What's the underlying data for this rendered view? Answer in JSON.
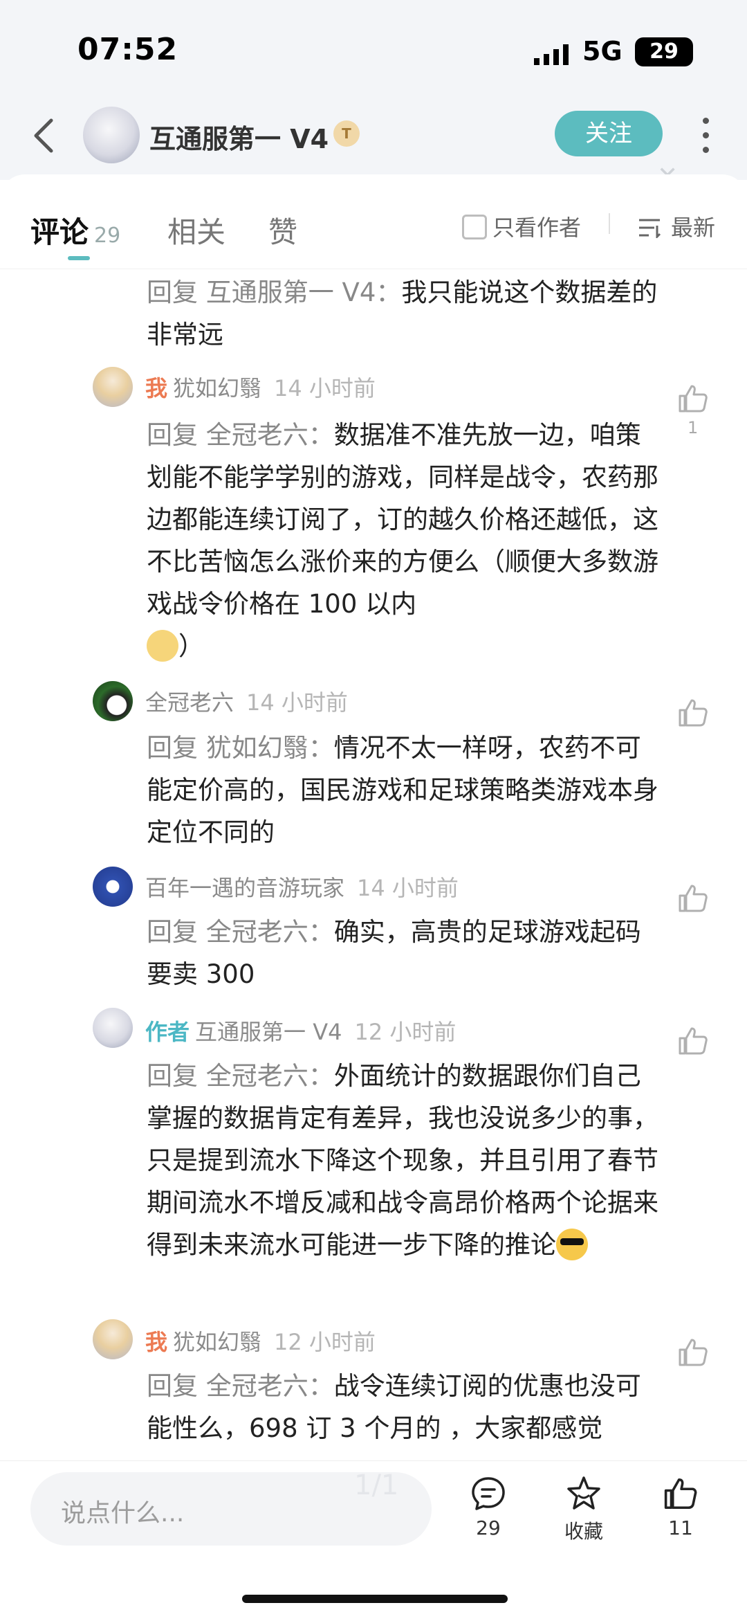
{
  "status": {
    "time": "07:52",
    "network": "5G",
    "battery": "29"
  },
  "header": {
    "username": "互通服第一 V4",
    "badge": "T",
    "follow_label": "关注"
  },
  "tabs": {
    "comments_label": "评论",
    "comments_count": "29",
    "related_label": "相关",
    "likes_label": "赞",
    "only_author_label": "只看作者",
    "sort_label": "最新"
  },
  "comments": [
    {
      "reply_prefix": "回复 互通服第一 V4：",
      "body": "我只能说这个数据差的非常远"
    },
    {
      "is_me": "我",
      "author": "犹如幻翳",
      "time": "14 小时前",
      "reply_prefix": "回复 全冠老六：",
      "body": "数据准不准先放一边，咱策划能不能学学别的游戏，同样是战令，农药那边都能连续订阅了，订的越久价格还越低，这不比苦恼怎么涨价来的方便么（顺便大多数游戏战令价格在 100 以内",
      "body_tail": "）",
      "likes": "1"
    },
    {
      "author": "全冠老六",
      "time": "14 小时前",
      "reply_prefix": "回复 犹如幻翳：",
      "body": "情况不太一样呀，农药不可能定价高的，国民游戏和足球策略类游戏本身定位不同的"
    },
    {
      "author": "百年一遇的音游玩家",
      "time": "14 小时前",
      "reply_prefix": "回复 全冠老六：",
      "body": "确实，高贵的足球游戏起码要卖 300"
    },
    {
      "author_tag": "作者",
      "author": "互通服第一 V4",
      "time": "12 小时前",
      "reply_prefix": "回复 全冠老六：",
      "body": "外面统计的数据跟你们自己掌握的数据肯定有差异，我也没说多少的事，只是提到流水下降这个现象，并且引用了春节期间流水不增反减和战令高昂价格两个论据来得到未来流水可能进一步下降的推论"
    },
    {
      "is_me": "我",
      "author": "犹如幻翳",
      "time": "12 小时前",
      "reply_prefix": "回复 全冠老六：",
      "body": "战令连续订阅的优惠也没可能性么，698 订 3 个月的 ，大家都感觉"
    }
  ],
  "bottom": {
    "input_placeholder": "说点什么...",
    "page_indicator": "1/1",
    "comment_count": "29",
    "favorite_label": "收藏",
    "like_count": "11"
  }
}
